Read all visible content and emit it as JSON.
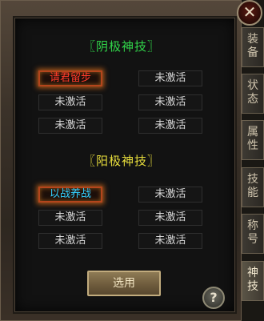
{
  "close_symbol": "✕",
  "tabs": [
    {
      "line1": "装",
      "line2": "备",
      "active": false
    },
    {
      "line1": "状",
      "line2": "态",
      "active": false
    },
    {
      "line1": "属",
      "line2": "性",
      "active": false
    },
    {
      "line1": "技",
      "line2": "能",
      "active": false
    },
    {
      "line1": "称",
      "line2": "号",
      "active": false
    },
    {
      "line1": "神",
      "line2": "技",
      "active": true
    }
  ],
  "yin_section": {
    "title": "〖阴极神技〗",
    "slots": [
      "请君留步",
      "未激活",
      "未激活",
      "未激活",
      "未激活",
      "未激活"
    ]
  },
  "yang_section": {
    "title": "〖阳极神技〗",
    "slots": [
      "以战养战",
      "未激活",
      "未激活",
      "未激活",
      "未激活",
      "未激活"
    ]
  },
  "confirm_label": "选用",
  "help_symbol": "?",
  "colors": {
    "yin_title": "#31d64a",
    "yang_title": "#e7dd3c",
    "active_skill_yin": "#ff3b2a",
    "active_skill_yang": "#33d0ff",
    "inactive_text": "#d8d8d8"
  }
}
